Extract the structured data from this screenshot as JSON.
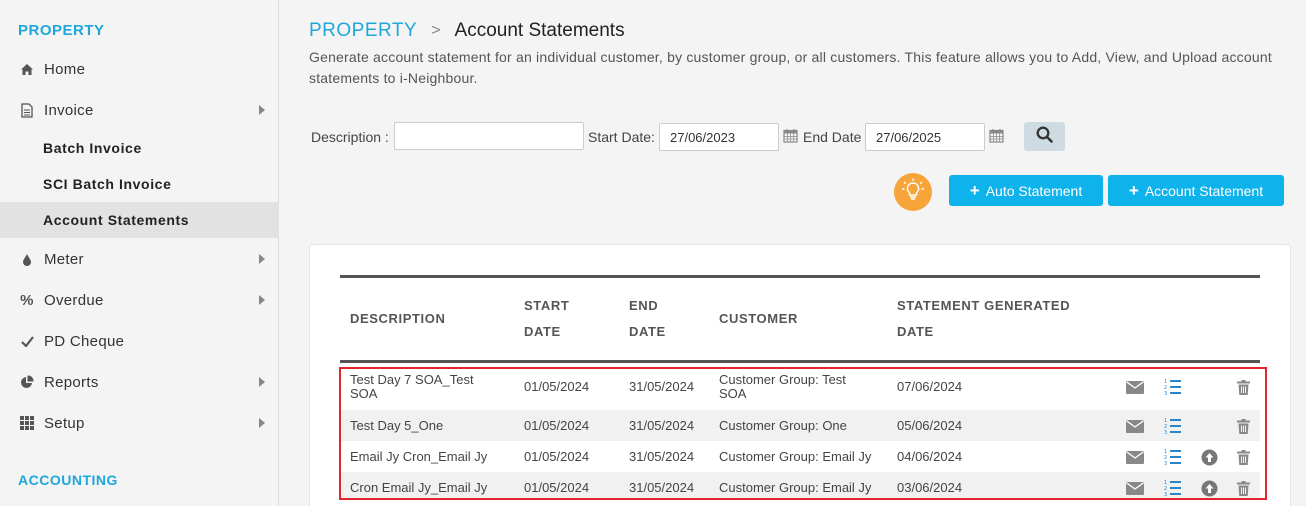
{
  "sidebar": {
    "section_property": "PROPERTY",
    "section_accounting": "ACCOUNTING",
    "items": {
      "home": "Home",
      "invoice": "Invoice",
      "batch_invoice": "Batch Invoice",
      "sci_batch_invoice": "SCI Batch Invoice",
      "account_statements": "Account Statements",
      "meter": "Meter",
      "overdue": "Overdue",
      "pd_cheque": "PD Cheque",
      "reports": "Reports",
      "setup": "Setup"
    }
  },
  "breadcrumb": {
    "root": "PROPERTY",
    "separator": ">",
    "current": "Account Statements"
  },
  "description": "Generate account statement for an individual customer, by customer group, or all customers. This feature allows you to Add, View, and Upload account statements to i-Neighbour.",
  "filters": {
    "description_label": "Description :",
    "description_value": "",
    "start_label": "Start Date:",
    "start_value": "27/06/2023",
    "end_label": "End Date",
    "end_value": "27/06/2025"
  },
  "buttons": {
    "auto_statement": "Auto Statement",
    "account_statement": "Account Statement"
  },
  "table": {
    "headers": {
      "description": "DESCRIPTION",
      "start_1": "START",
      "start_2": "DATE",
      "end_1": "END",
      "end_2": "DATE",
      "customer": "CUSTOMER",
      "generated_1": "STATEMENT GENERATED",
      "generated_2": "DATE"
    },
    "rows": [
      {
        "description": "Test Day 7 SOA_Test SOA",
        "start": "01/05/2024",
        "end": "31/05/2024",
        "customer": "Customer Group: Test SOA",
        "generated": "07/06/2024"
      },
      {
        "description": "Test Day 5_One",
        "start": "01/05/2024",
        "end": "31/05/2024",
        "customer": "Customer Group: One",
        "generated": "05/06/2024"
      },
      {
        "description": "Email Jy Cron_Email Jy",
        "start": "01/05/2024",
        "end": "31/05/2024",
        "customer": "Customer Group: Email Jy",
        "generated": "04/06/2024"
      },
      {
        "description": "Cron Email Jy_Email Jy",
        "start": "01/05/2024",
        "end": "31/05/2024",
        "customer": "Customer Group: Email Jy",
        "generated": "03/06/2024"
      }
    ]
  },
  "colors": {
    "accent": "#1fa7dc",
    "button": "#0fb3ec",
    "bulb": "#f7a53a",
    "highlight": "#e3262e"
  }
}
